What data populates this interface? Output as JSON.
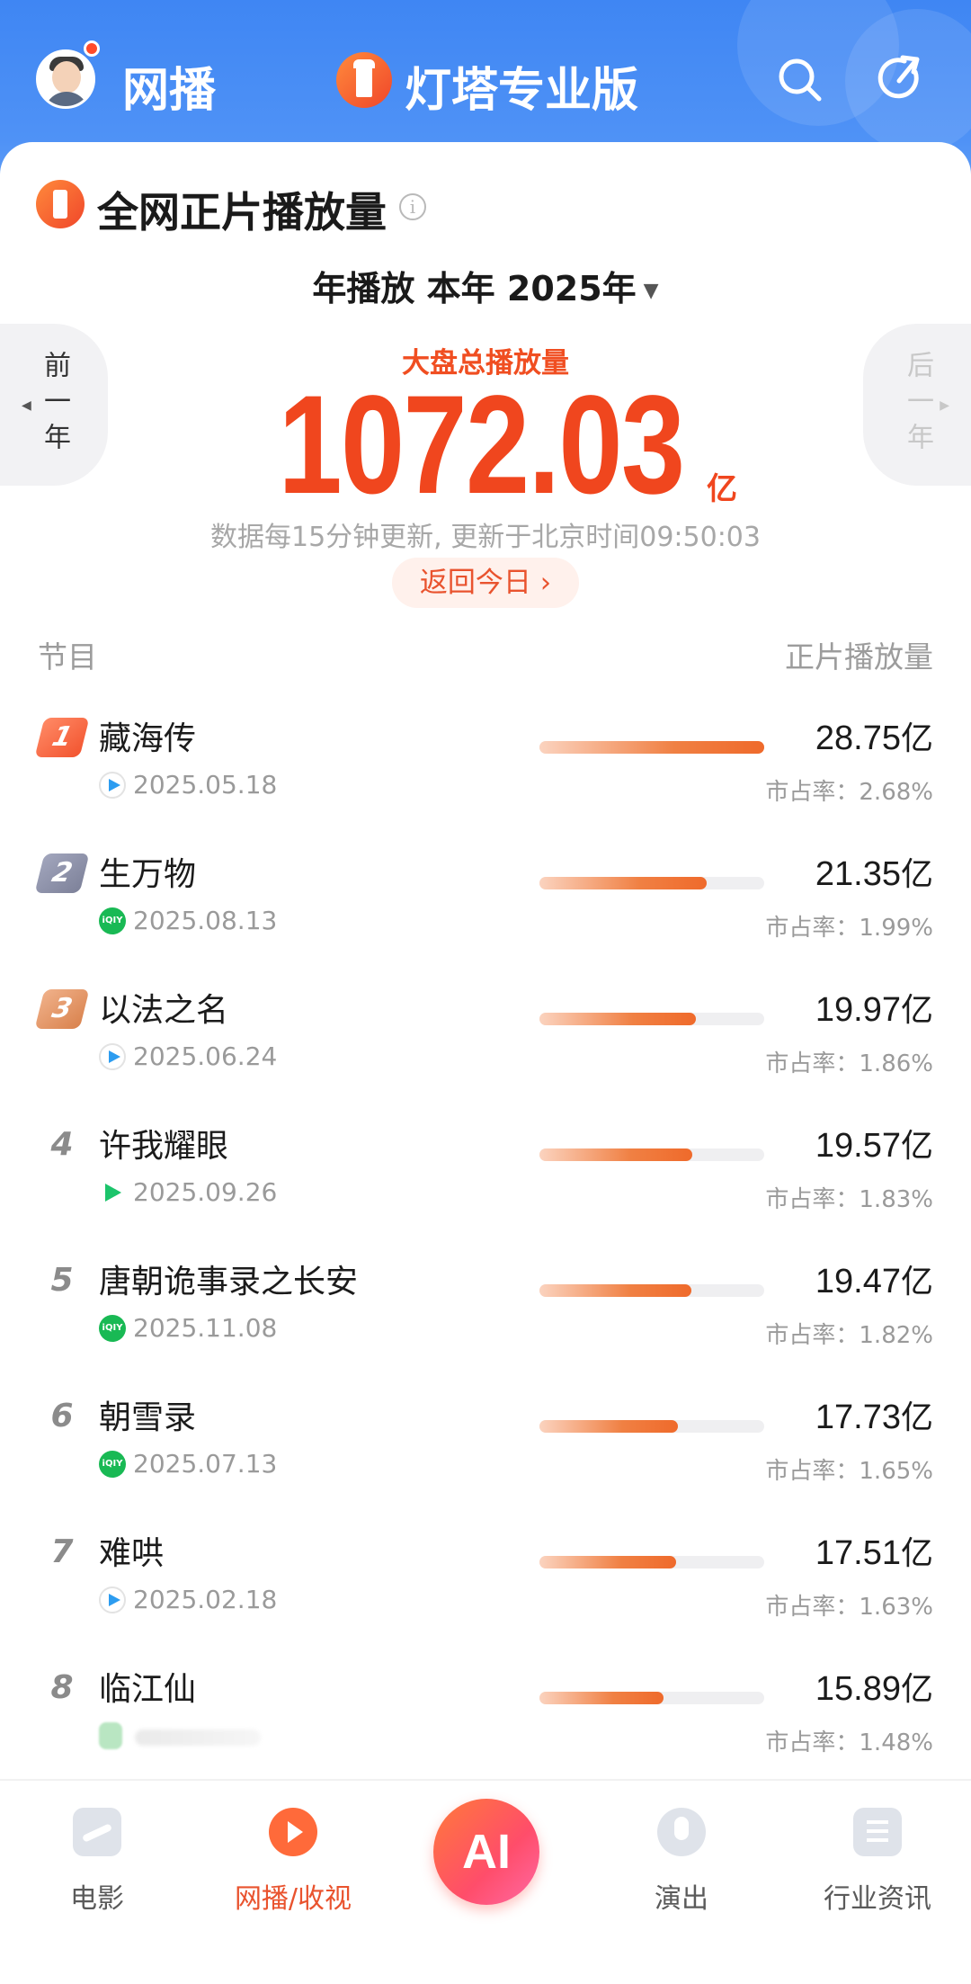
{
  "header": {
    "left_label": "网播",
    "app_title": "灯塔专业版",
    "icons": [
      "avatar",
      "logo-lighthouse-icon",
      "search-icon",
      "share-icon"
    ]
  },
  "section": {
    "title": "全网正片播放量",
    "info_symbol": "i"
  },
  "period_selector": {
    "label": "年播放 本年 2025年"
  },
  "prev_year": "前一年",
  "next_year": "后一年",
  "total": {
    "label": "大盘总播放量",
    "value": "1072.03",
    "unit": "亿"
  },
  "update_note": "数据每15分钟更新, 更新于北京时间09:50:03",
  "today_button": "返回今日 ›",
  "table": {
    "col_left": "节目",
    "col_right": "正片播放量",
    "rows": [
      {
        "rank": "1",
        "name": "藏海传",
        "platform": "youku",
        "date": "2025.05.18",
        "value": "28.75",
        "unit": "亿",
        "share": "市占率：2.68%",
        "bar": 1.0
      },
      {
        "rank": "2",
        "name": "生万物",
        "platform": "iqiyi",
        "date": "2025.08.13",
        "value": "21.35",
        "unit": "亿",
        "share": "市占率：1.99%",
        "bar": 0.743
      },
      {
        "rank": "3",
        "name": "以法之名",
        "platform": "youku",
        "date": "2025.06.24",
        "value": "19.97",
        "unit": "亿",
        "share": "市占率：1.86%",
        "bar": 0.695
      },
      {
        "rank": "4",
        "name": "许我耀眼",
        "platform": "tencent",
        "date": "2025.09.26",
        "value": "19.57",
        "unit": "亿",
        "share": "市占率：1.83%",
        "bar": 0.681
      },
      {
        "rank": "5",
        "name": "唐朝诡事录之长安",
        "platform": "iqiyi",
        "date": "2025.11.08",
        "value": "19.47",
        "unit": "亿",
        "share": "市占率：1.82%",
        "bar": 0.677
      },
      {
        "rank": "6",
        "name": "朝雪录",
        "platform": "iqiyi",
        "date": "2025.07.13",
        "value": "17.73",
        "unit": "亿",
        "share": "市占率：1.65%",
        "bar": 0.617
      },
      {
        "rank": "7",
        "name": "难哄",
        "platform": "youku",
        "date": "2025.02.18",
        "value": "17.51",
        "unit": "亿",
        "share": "市占率：1.63%",
        "bar": 0.609
      },
      {
        "rank": "8",
        "name": "临江仙",
        "platform": "blurred",
        "date": "",
        "value": "15.89",
        "unit": "亿",
        "share": "市占率：1.48%",
        "bar": 0.553
      }
    ]
  },
  "bottom_nav": [
    {
      "label": "电影",
      "icon": "film-icon",
      "active": false
    },
    {
      "label": "网播/收视",
      "icon": "play-icon",
      "active": true
    },
    {
      "label": "AI",
      "icon": "ai-icon",
      "active": false
    },
    {
      "label": "演出",
      "icon": "mic-icon",
      "active": false
    },
    {
      "label": "行业资讯",
      "icon": "news-icon",
      "active": false
    }
  ],
  "colors": {
    "header_blue": "#4a8ff5",
    "accent_orange": "#f0461e",
    "bar_orange": "#ef6a2b"
  }
}
